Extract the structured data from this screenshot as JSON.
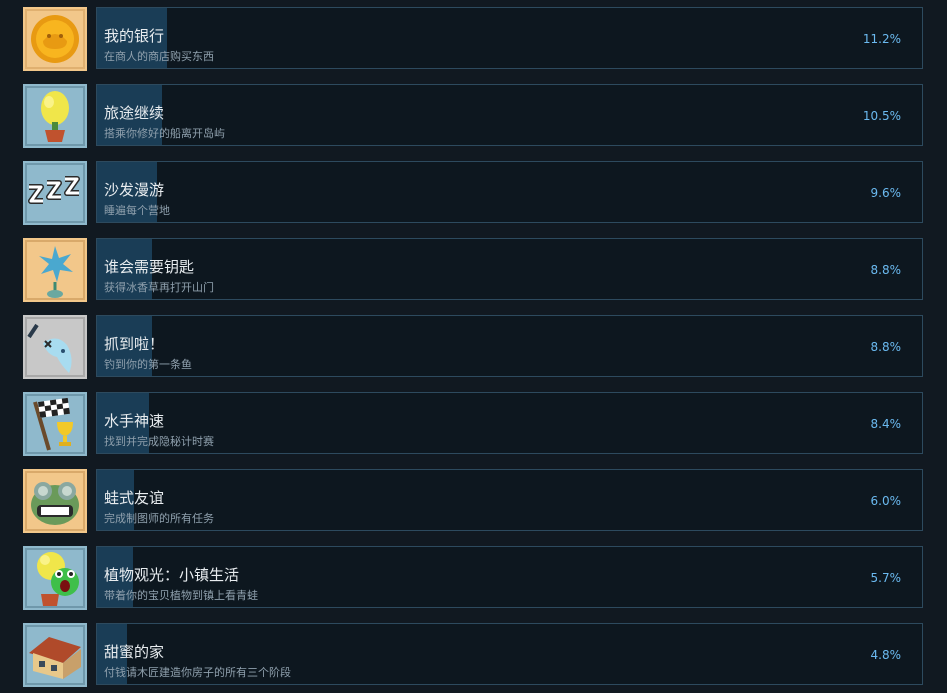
{
  "achievements": [
    {
      "title": "我的银行",
      "description": "在商人的商店购买东西",
      "percent": "11.2%",
      "fraction": 0.112,
      "icon": "coin-icon",
      "bg": "#f2c78a"
    },
    {
      "title": "旅途继续",
      "description": "搭乘你修好的船离开岛屿",
      "percent": "10.5%",
      "fraction": 0.105,
      "icon": "yellow-plant-icon",
      "bg": "#8fb9cc"
    },
    {
      "title": "沙发漫游",
      "description": "睡遍每个营地",
      "percent": "9.6%",
      "fraction": 0.096,
      "icon": "zzz-sleep-icon",
      "bg": "#8fb9cc"
    },
    {
      "title": "谁会需要钥匙",
      "description": "获得冰香草再打开山门",
      "percent": "8.8%",
      "fraction": 0.088,
      "icon": "ice-flower-icon",
      "bg": "#f2c78a"
    },
    {
      "title": "抓到啦！",
      "description": "钓到你的第一条鱼",
      "percent": "8.8%",
      "fraction": 0.088,
      "icon": "fish-icon",
      "bg": "#c8c8c8"
    },
    {
      "title": "水手神速",
      "description": "找到并完成隐秘计时赛",
      "percent": "8.4%",
      "fraction": 0.084,
      "icon": "checkered-flag-trophy-icon",
      "bg": "#8fb9cc"
    },
    {
      "title": "蛙式友谊",
      "description": "完成制图师的所有任务",
      "percent": "6.0%",
      "fraction": 0.06,
      "icon": "frog-face-icon",
      "bg": "#f2c78a"
    },
    {
      "title": "植物观光：小镇生活",
      "description": "带着你的宝贝植物到镇上看青蛙",
      "percent": "5.7%",
      "fraction": 0.057,
      "icon": "plant-frog-icon",
      "bg": "#8fb9cc"
    },
    {
      "title": "甜蜜的家",
      "description": "付钱请木匠建造你房子的所有三个阶段",
      "percent": "4.8%",
      "fraction": 0.048,
      "icon": "house-icon",
      "bg": "#8fb9cc"
    }
  ]
}
